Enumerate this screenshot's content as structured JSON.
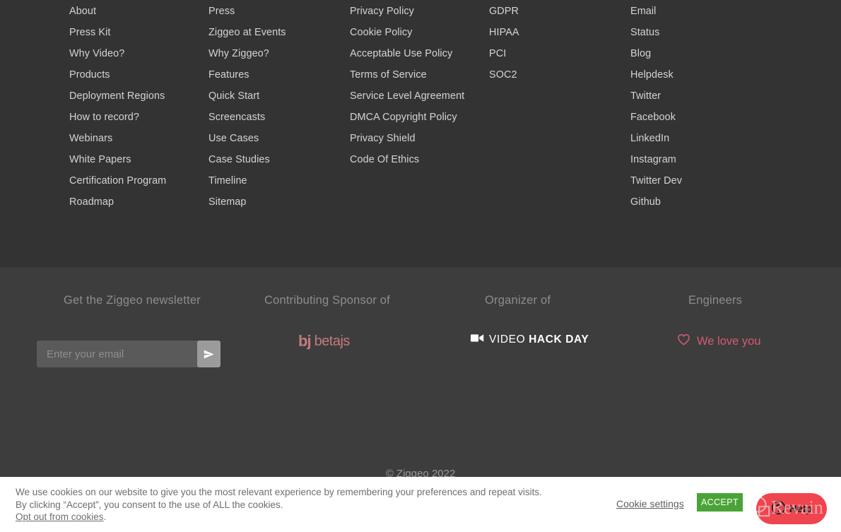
{
  "footer": {
    "columns": [
      {
        "name": "company",
        "links": [
          "About",
          "Press Kit",
          "Why Video?",
          "Products",
          "Deployment Regions",
          "How to record?",
          "Webinars",
          "White Papers",
          "Certification Program",
          "Roadmap"
        ]
      },
      {
        "name": "resources",
        "links": [
          "Press",
          "Ziggeo at Events",
          "Why Ziggeo?",
          "Features",
          "Quick Start",
          "Screencasts",
          "Use Cases",
          "Case Studies",
          "Timeline",
          "Sitemap"
        ]
      },
      {
        "name": "legal",
        "links": [
          "Privacy Policy",
          "Cookie Policy",
          "Acceptable Use Policy",
          "Terms of Service",
          "Service Level Agreement",
          "DMCA Copyright Policy",
          "Privacy Shield",
          "Code Of Ethics"
        ]
      },
      {
        "name": "compliance",
        "links": [
          "GDPR",
          "HIPAA",
          "PCI",
          "SOC2"
        ]
      },
      {
        "name": "contact-social",
        "links": [
          "Email",
          "Status",
          "Blog",
          "Helpdesk",
          "Twitter",
          "Facebook",
          "LinkedIn",
          "Instagram",
          "Twitter Dev",
          "Github"
        ]
      }
    ]
  },
  "bottom": {
    "newsletter": {
      "title": "Get the Ziggeo newsletter",
      "placeholder": "Enter your email",
      "value": "",
      "submit_icon": "paper-plane-icon"
    },
    "sponsor": {
      "title": "Contributing Sponsor of",
      "logo_mark": "bj",
      "logo_word": "betajs",
      "logo_color": "#c4797f"
    },
    "organizer": {
      "title": "Organizer of",
      "logo_icon": "video-camera-icon",
      "logo_text_light": "VIDEO ",
      "logo_text_bold": "HACK DAY",
      "logo_color": "#ffffff"
    },
    "engineers": {
      "title": "Engineers",
      "icon": "heart-outline-icon",
      "label": "We love you",
      "color": "#d65a72"
    },
    "copyright": "© Ziggeo 2022"
  },
  "cookie_banner": {
    "line1": "We use cookies on our website to give you the most relevant experience by remembering your preferences and repeat visits.",
    "line2": "By clicking “Accept”, you consent to the use of ALL the cookies.",
    "optout_label": "Opt out from cookies",
    "optout_suffix": ".",
    "settings_label": "Cookie settings",
    "accept_label": "ACCEPT",
    "accept_color": "#4aa336"
  },
  "help_widget": {
    "label": "Help",
    "icon": "question-circle-icon",
    "color": "#f0444f"
  },
  "watermark": {
    "text": "Revain"
  }
}
